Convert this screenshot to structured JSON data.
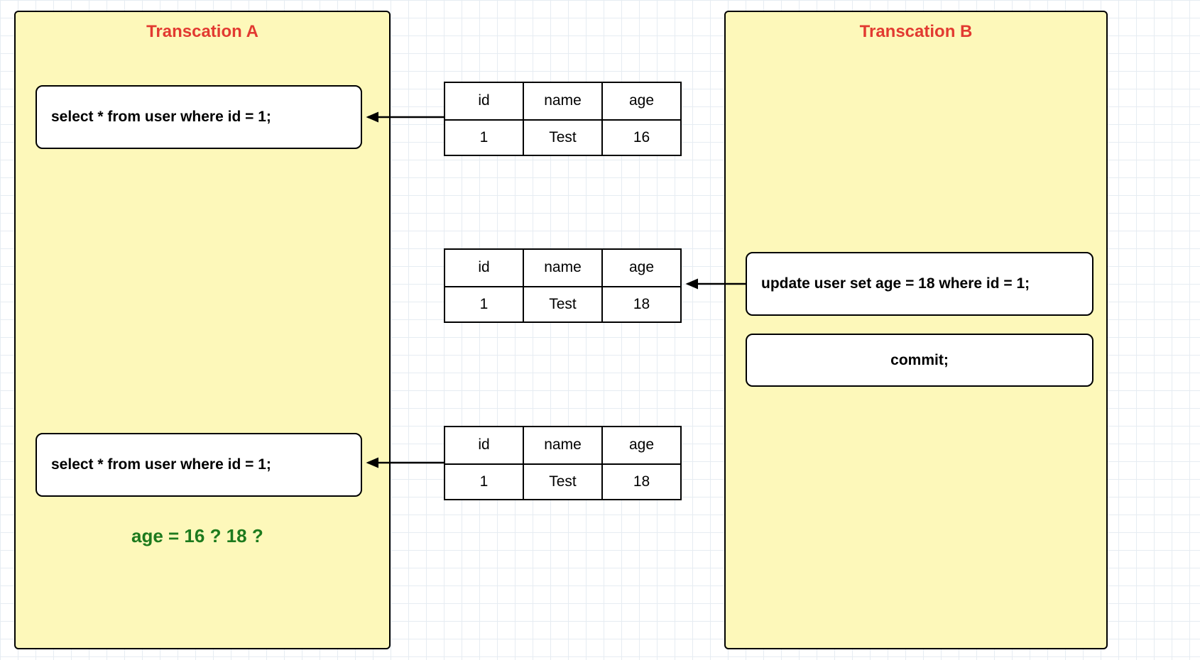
{
  "transactionA": {
    "title": "Transcation A",
    "select1": "select * from user where id = 1;",
    "select2": "select * from user where id = 1;",
    "question": "age = 16 ? 18 ?"
  },
  "transactionB": {
    "title": "Transcation B",
    "update": "update user set age = 18 where id = 1;",
    "commit": "commit;"
  },
  "tables": {
    "headers": {
      "id": "id",
      "name": "name",
      "age": "age"
    },
    "row1": {
      "id": "1",
      "name": "Test",
      "age": "16"
    },
    "row2": {
      "id": "1",
      "name": "Test",
      "age": "18"
    },
    "row3": {
      "id": "1",
      "name": "Test",
      "age": "18"
    }
  }
}
